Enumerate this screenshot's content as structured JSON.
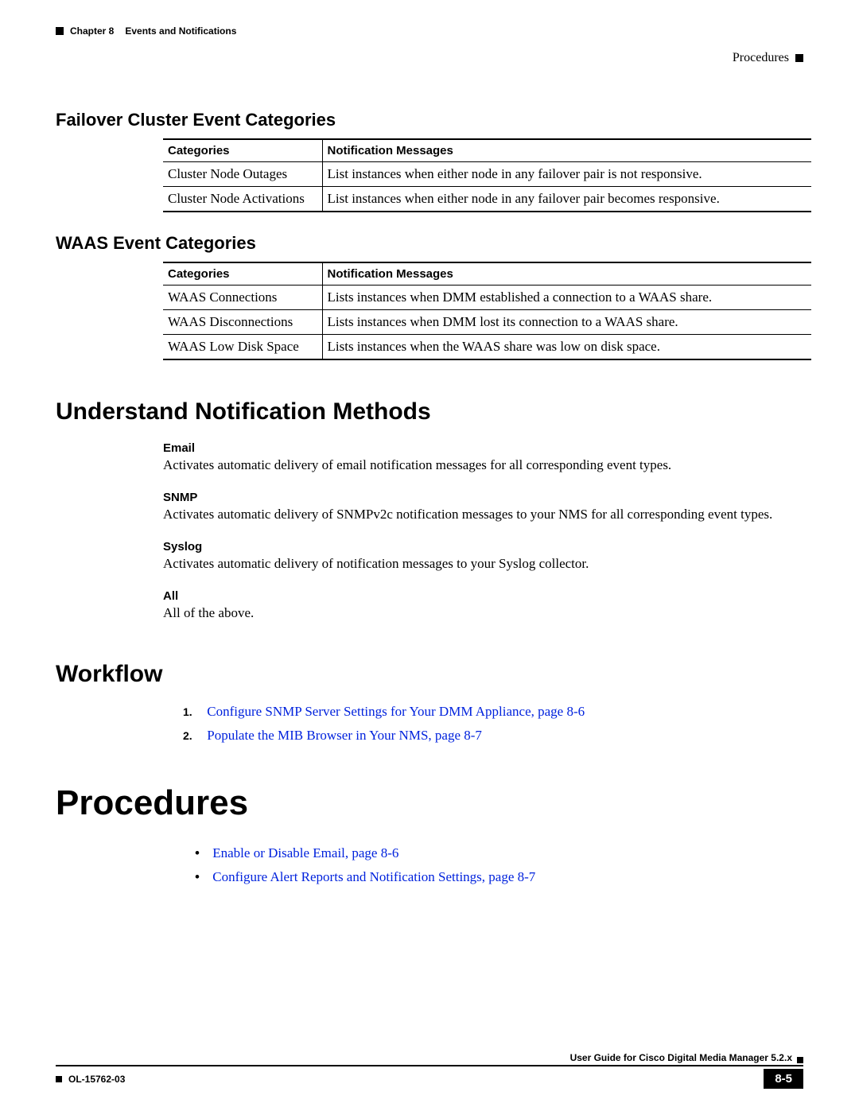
{
  "header": {
    "chapter": "Chapter 8",
    "title": "Events and Notifications",
    "rightLabel": "Procedures"
  },
  "sections": {
    "failover": {
      "heading": "Failover Cluster Event Categories",
      "col1": "Categories",
      "col2": "Notification Messages",
      "rows": [
        {
          "cat": "Cluster Node Outages",
          "msg": "List instances when either node in any failover pair is not responsive."
        },
        {
          "cat": "Cluster Node Activations",
          "msg": "List instances when either node in any failover pair becomes responsive."
        }
      ]
    },
    "waas": {
      "heading": "WAAS Event Categories",
      "col1": "Categories",
      "col2": "Notification Messages",
      "rows": [
        {
          "cat": "WAAS Connections",
          "msg": "Lists instances when DMM established a connection to a WAAS share."
        },
        {
          "cat": "WAAS Disconnections",
          "msg": "Lists instances when DMM lost its connection to a WAAS share."
        },
        {
          "cat": "WAAS Low Disk Space",
          "msg": "Lists instances when the WAAS share was low on disk space."
        }
      ]
    },
    "understand": {
      "heading": "Understand Notification Methods",
      "items": [
        {
          "label": "Email",
          "text": "Activates automatic delivery of email notification messages for all corresponding event types."
        },
        {
          "label": "SNMP",
          "text": "Activates automatic delivery of SNMPv2c notification messages to your NMS for all corresponding event types."
        },
        {
          "label": "Syslog",
          "text": "Activates automatic delivery of notification messages to your Syslog collector."
        },
        {
          "label": "All",
          "text": "All of the above."
        }
      ]
    },
    "workflow": {
      "heading": "Workflow",
      "items": [
        {
          "num": "1.",
          "text": "Configure SNMP Server Settings for Your DMM Appliance, page 8-6"
        },
        {
          "num": "2.",
          "text": "Populate the MIB Browser in Your NMS, page 8-7"
        }
      ]
    },
    "procedures": {
      "heading": "Procedures",
      "items": [
        {
          "text": "Enable or Disable Email, page 8-6"
        },
        {
          "text": "Configure Alert Reports and Notification Settings, page 8-7"
        }
      ]
    }
  },
  "footer": {
    "guide": "User Guide for Cisco Digital Media Manager 5.2.x",
    "docnum": "OL-15762-03",
    "page": "8-5"
  }
}
